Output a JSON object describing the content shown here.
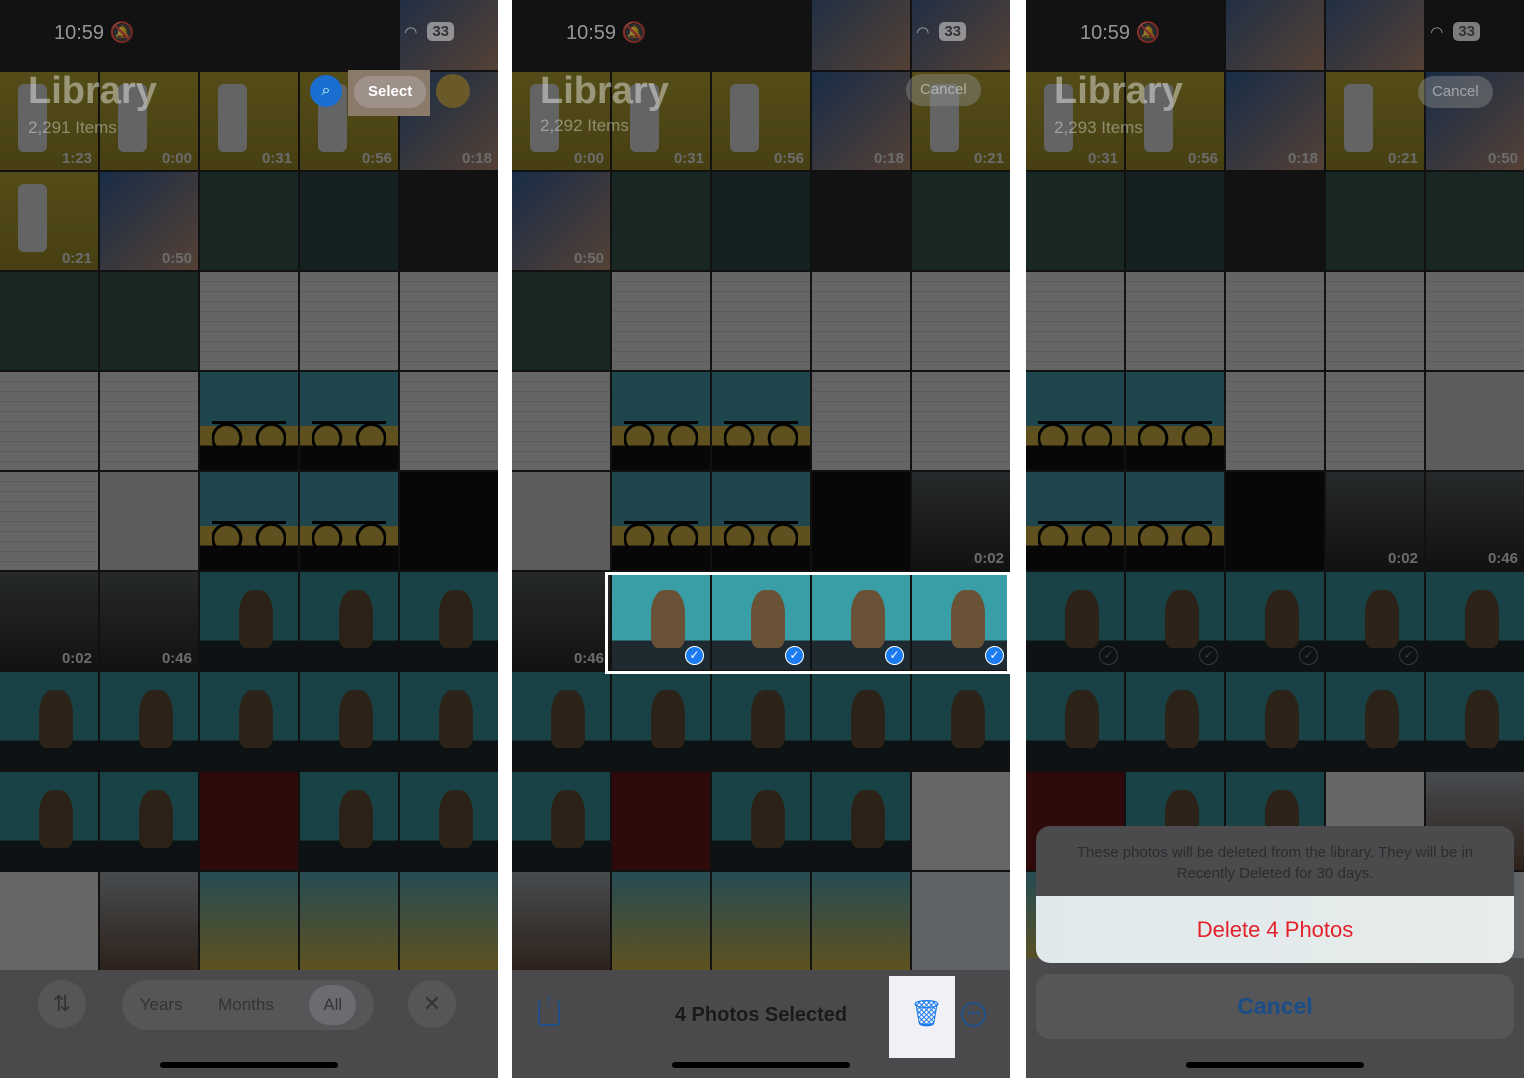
{
  "status": {
    "time": "10:59",
    "battery": "33"
  },
  "panels": [
    {
      "title": "Library",
      "count": "2,291 Items",
      "top_button": "Select",
      "tiles": [
        [
          "settings-dark",
          ""
        ],
        [
          "settings-dark",
          ""
        ],
        [
          "settings-dark",
          ""
        ],
        [
          "settings-dark",
          ""
        ],
        [
          "hand",
          ""
        ],
        [
          "phone",
          "1:23"
        ],
        [
          "phone",
          "0:00"
        ],
        [
          "phone",
          "0:31"
        ],
        [
          "phone",
          "0:56"
        ],
        [
          "hand",
          "0:18"
        ],
        [
          "phone",
          "0:21"
        ],
        [
          "hand",
          "0:50"
        ],
        [
          "cc",
          ""
        ],
        [
          "cc-apps",
          ""
        ],
        [
          "settings-dark",
          ""
        ],
        [
          "cc",
          ""
        ],
        [
          "cc",
          ""
        ],
        [
          "settings",
          ""
        ],
        [
          "settings",
          ""
        ],
        [
          "settings",
          ""
        ],
        [
          "settings",
          ""
        ],
        [
          "settings",
          ""
        ],
        [
          "bike",
          ""
        ],
        [
          "bike",
          ""
        ],
        [
          "settings",
          ""
        ],
        [
          "settings",
          ""
        ],
        [
          "mac",
          ""
        ],
        [
          "bike",
          ""
        ],
        [
          "bike",
          ""
        ],
        [
          "watch",
          ""
        ],
        [
          "phone-dark",
          "0:02"
        ],
        [
          "phone-dark",
          "0:46"
        ],
        [
          "groot",
          ""
        ],
        [
          "groot",
          ""
        ],
        [
          "groot",
          ""
        ],
        [
          "groot",
          ""
        ],
        [
          "groot",
          ""
        ],
        [
          "groot",
          ""
        ],
        [
          "groot",
          ""
        ],
        [
          "groot",
          ""
        ],
        [
          "groot",
          ""
        ],
        [
          "groot",
          ""
        ],
        [
          "red",
          ""
        ],
        [
          "groot",
          ""
        ],
        [
          "groot",
          ""
        ],
        [
          "mail",
          ""
        ],
        [
          "person",
          ""
        ],
        [
          "app",
          ""
        ],
        [
          "app",
          ""
        ],
        [
          "app",
          ""
        ]
      ],
      "bottom": {
        "segments": [
          "Years",
          "Months",
          "All"
        ],
        "active": "All"
      }
    },
    {
      "title": "Library",
      "count": "2,292 Items",
      "top_button": "Cancel",
      "tiles": [
        [
          "settings-dark",
          ""
        ],
        [
          "settings-dark",
          ""
        ],
        [
          "settings-dark",
          ""
        ],
        [
          "hand",
          ""
        ],
        [
          "hand",
          ""
        ],
        [
          "phone",
          "0:00"
        ],
        [
          "phone",
          "0:31"
        ],
        [
          "phone",
          "0:56"
        ],
        [
          "hand",
          "0:18"
        ],
        [
          "phone",
          "0:21"
        ],
        [
          "hand",
          "0:50"
        ],
        [
          "cc",
          ""
        ],
        [
          "cc-apps",
          ""
        ],
        [
          "settings-dark",
          ""
        ],
        [
          "cc",
          ""
        ],
        [
          "cc",
          ""
        ],
        [
          "settings",
          ""
        ],
        [
          "settings",
          ""
        ],
        [
          "settings",
          ""
        ],
        [
          "settings",
          ""
        ],
        [
          "settings",
          ""
        ],
        [
          "bike",
          ""
        ],
        [
          "bike",
          ""
        ],
        [
          "settings",
          ""
        ],
        [
          "settings",
          ""
        ],
        [
          "mac",
          ""
        ],
        [
          "bike",
          ""
        ],
        [
          "bike",
          ""
        ],
        [
          "watch",
          ""
        ],
        [
          "phone-dark",
          "0:02"
        ],
        [
          "phone-dark",
          "0:46"
        ],
        [
          "groot",
          "sel"
        ],
        [
          "groot",
          "sel"
        ],
        [
          "groot",
          "sel"
        ],
        [
          "groot",
          "sel"
        ],
        [
          "groot",
          ""
        ],
        [
          "groot",
          ""
        ],
        [
          "groot",
          ""
        ],
        [
          "groot",
          ""
        ],
        [
          "groot",
          ""
        ],
        [
          "groot",
          ""
        ],
        [
          "red",
          ""
        ],
        [
          "groot",
          ""
        ],
        [
          "groot",
          ""
        ],
        [
          "mail",
          ""
        ],
        [
          "person",
          ""
        ],
        [
          "app",
          ""
        ],
        [
          "app",
          ""
        ],
        [
          "app",
          ""
        ],
        [
          "grid",
          ""
        ]
      ],
      "bottom": {
        "selected_text": "4 Photos Selected"
      }
    },
    {
      "title": "Library",
      "count": "2,293 Items",
      "top_button": "Cancel",
      "tiles": [
        [
          "settings-dark",
          ""
        ],
        [
          "settings-dark",
          ""
        ],
        [
          "hand",
          ""
        ],
        [
          "hand",
          ""
        ],
        [
          "settings-dark",
          ""
        ],
        [
          "phone",
          "0:31"
        ],
        [
          "phone",
          "0:56"
        ],
        [
          "hand",
          "0:18"
        ],
        [
          "phone",
          "0:21"
        ],
        [
          "hand",
          "0:50"
        ],
        [
          "cc",
          ""
        ],
        [
          "cc-apps",
          ""
        ],
        [
          "settings-dark",
          ""
        ],
        [
          "cc",
          ""
        ],
        [
          "cc",
          ""
        ],
        [
          "settings",
          ""
        ],
        [
          "settings",
          ""
        ],
        [
          "settings",
          ""
        ],
        [
          "settings",
          ""
        ],
        [
          "settings",
          ""
        ],
        [
          "bike",
          ""
        ],
        [
          "bike",
          ""
        ],
        [
          "settings",
          ""
        ],
        [
          "settings",
          ""
        ],
        [
          "mac",
          ""
        ],
        [
          "bike",
          ""
        ],
        [
          "bike",
          ""
        ],
        [
          "watch",
          ""
        ],
        [
          "phone-dark",
          "0:02"
        ],
        [
          "phone-dark",
          "0:46"
        ],
        [
          "groot",
          "dim"
        ],
        [
          "groot",
          "dim"
        ],
        [
          "groot",
          "dim"
        ],
        [
          "groot",
          "dim"
        ],
        [
          "groot",
          ""
        ],
        [
          "groot",
          ""
        ],
        [
          "groot",
          ""
        ],
        [
          "groot",
          ""
        ],
        [
          "groot",
          ""
        ],
        [
          "groot",
          ""
        ],
        [
          "red",
          ""
        ],
        [
          "groot",
          ""
        ],
        [
          "groot",
          ""
        ],
        [
          "mail",
          ""
        ],
        [
          "person",
          ""
        ],
        [
          "app",
          ""
        ],
        [
          "app",
          ""
        ],
        [
          "app",
          ""
        ],
        [
          "grid",
          ""
        ],
        [
          "grid",
          ""
        ]
      ],
      "sheet": {
        "message": "These photos will be deleted from the library. They will be in Recently Deleted for 30 days.",
        "delete_label": "Delete 4 Photos",
        "cancel_label": "Cancel"
      }
    }
  ],
  "colors": {
    "accent": "#1a7cf0",
    "destructive": "#e3222b"
  }
}
